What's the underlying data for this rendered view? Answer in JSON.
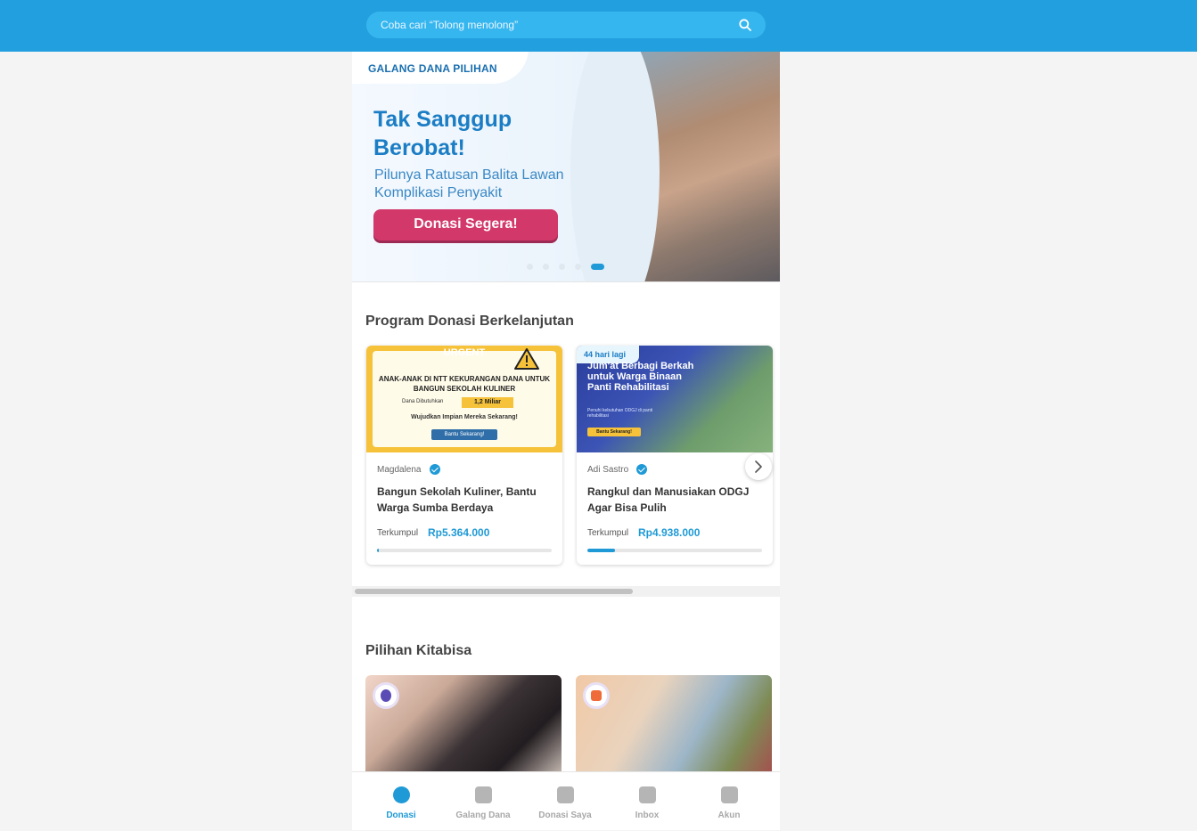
{
  "search": {
    "placeholder": "Coba cari “Tolong menolong”"
  },
  "banner": {
    "tag": "GALANG DANA PILIHAN",
    "headline": "Tak Sanggup Berobat!",
    "subtitle": "Pilunya Ratusan Balita Lawan Komplikasi Penyakit",
    "cta": "Donasi Segera!",
    "slides": 5,
    "active_slide": 5
  },
  "program": {
    "title": "Program Donasi Berkelanjutan",
    "cards": [
      {
        "image": {
          "label": "URGENT",
          "headline": "ANAK-ANAK DI NTT KEKURANGAN DANA UNTUK BANGUN SEKOLAH KULINER",
          "need_label": "Dana Dibutuhkan",
          "need_value": "1,2 Miliar",
          "tagline": "Wujudkan Impian Mereka Sekarang!",
          "button": "Bantu Sekarang!"
        },
        "author": "Magdalena",
        "title": "Bangun Sekolah Kuliner, Bantu Warga Sumba Berdaya",
        "collected_label": "Terkumpul",
        "amount": "Rp5.364.000",
        "progress": 0.01
      },
      {
        "image": {
          "days_left": "44 hari lagi",
          "headline": "Jum'at Berbagi Berkah untuk Warga Binaan Panti Rehabilitasi",
          "note": "Penuhi kebutuhan ODGJ di panti rehabilitasi",
          "button": "Bantu Sekarang!"
        },
        "author": "Adi Sastro",
        "title": "Rangkul dan Manusiakan ODGJ Agar Bisa Pulih",
        "collected_label": "Terkumpul",
        "amount": "Rp4.938.000",
        "progress": 0.16
      }
    ]
  },
  "pilihan": {
    "title": "Pilihan Kitabisa"
  },
  "nav": {
    "items": [
      {
        "label": "Donasi",
        "icon": "heart-icon",
        "active": true
      },
      {
        "label": "Galang Dana",
        "icon": "donation-box-icon",
        "active": false
      },
      {
        "label": "Donasi Saya",
        "icon": "document-icon",
        "active": false
      },
      {
        "label": "Inbox",
        "icon": "mail-icon",
        "active": false
      },
      {
        "label": "Akun",
        "icon": "user-icon",
        "active": false
      }
    ]
  },
  "colors": {
    "primary": "#229fde",
    "accent": "#1f9ad6",
    "cta": "#d2386a"
  }
}
